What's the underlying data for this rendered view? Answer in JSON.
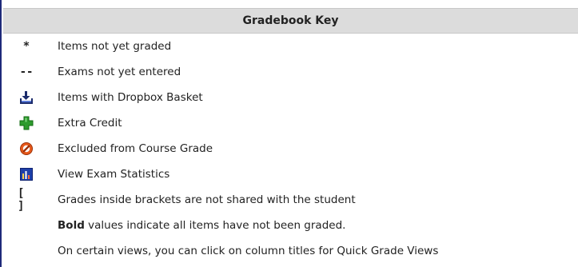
{
  "title": "Gradebook Key",
  "items": [
    {
      "symbol": "*",
      "icon": null,
      "label": "Items not yet graded"
    },
    {
      "symbol": "--",
      "icon": null,
      "label": "Exams not yet entered"
    },
    {
      "symbol": null,
      "icon": "dropbox-basket-icon",
      "label": "Items with Dropbox Basket"
    },
    {
      "symbol": null,
      "icon": "extra-credit-plus-icon",
      "label": "Extra Credit"
    },
    {
      "symbol": null,
      "icon": "excluded-no-icon",
      "label": "Excluded from Course Grade"
    },
    {
      "symbol": null,
      "icon": "exam-statistics-chart-icon",
      "label": "View Exam Statistics"
    },
    {
      "symbol": "[ ]",
      "icon": null,
      "label": "Grades inside brackets are not shared with the student"
    }
  ],
  "bold_note": {
    "bold_word": "Bold",
    "rest": " values indicate all items have not been graded."
  },
  "views_note": "On certain views, you can click on column titles for Quick Grade Views",
  "colors": {
    "header_bg": "#dcdcdc",
    "left_border": "#1f2a7a",
    "extra_credit_green": "#2e9b2e",
    "excluded_orange": "#e85a1b",
    "stats_blue": "#1f3fa8"
  }
}
